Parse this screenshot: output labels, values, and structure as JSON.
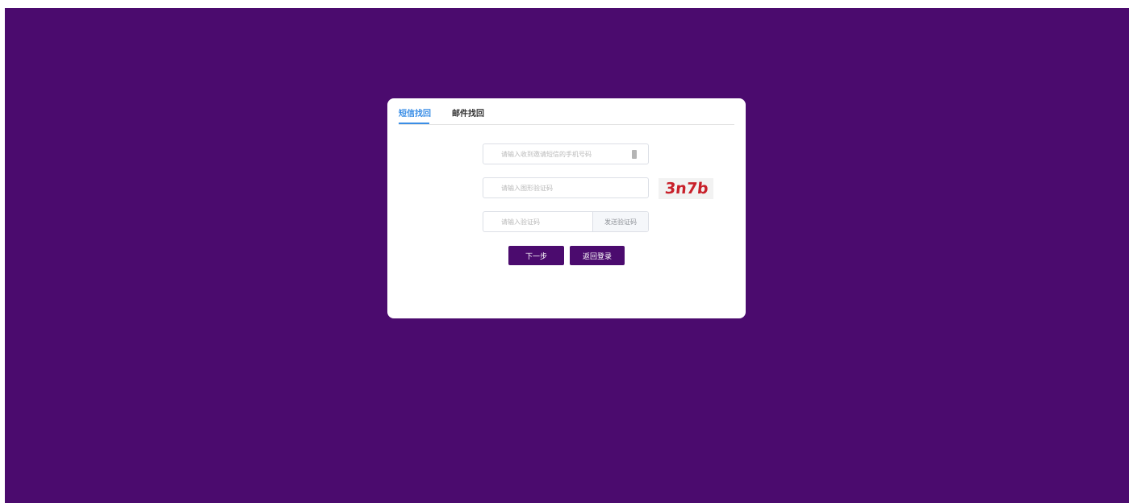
{
  "colors": {
    "background": "#4b0b6e",
    "accent": "#3a8ee6",
    "primary_button": "#4b0b6e",
    "captcha_text": "#c8202a"
  },
  "tabs": [
    {
      "label": "短信找回",
      "active": true
    },
    {
      "label": "邮件找回",
      "active": false
    }
  ],
  "form": {
    "phone": {
      "value": "",
      "placeholder": "请输入收到邀请短信的手机号码",
      "icon": "mobile-phone-icon"
    },
    "captcha": {
      "value": "",
      "placeholder": "请输入图形验证码",
      "image_text": "3n7b"
    },
    "sms_code": {
      "value": "",
      "placeholder": "请输入验证码",
      "send_label": "发送验证码"
    }
  },
  "actions": {
    "next_label": "下一步",
    "back_label": "返回登录"
  }
}
